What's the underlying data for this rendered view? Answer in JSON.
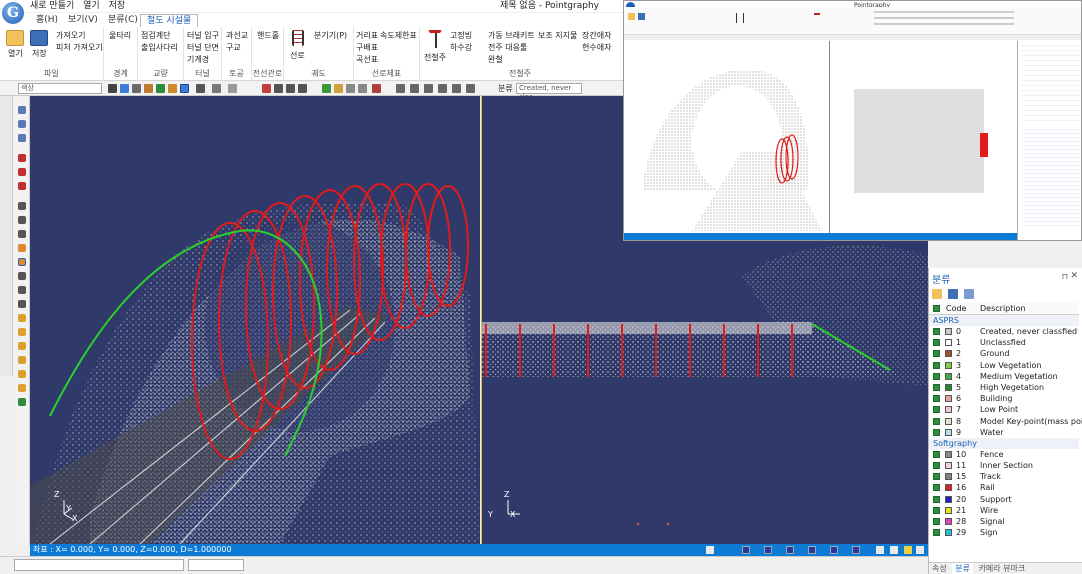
{
  "app": {
    "title": "제목 없음 - Pointgraphy",
    "logo_letter": "G",
    "quick_access": [
      "새로 만들기",
      "열기",
      "저장"
    ]
  },
  "ribbon_tabs": [
    {
      "label": "홈(H)"
    },
    {
      "label": "보기(V)"
    },
    {
      "label": "분류(C)"
    },
    {
      "label": "철도 시설물"
    }
  ],
  "ribbon": {
    "file": {
      "open": "열기",
      "save": "저장",
      "import": "가져오기",
      "feature_import": "피처 가져오기",
      "group": "파일"
    },
    "boundary": {
      "fence": "울타리",
      "group": "경계"
    },
    "bridge": {
      "stairs": "점검계단",
      "ladder": "출입사다리",
      "group": "교량"
    },
    "tunnel": {
      "entrance": "터널 입구",
      "section": "터널 단면",
      "machine_room": "기계경",
      "group": "터널"
    },
    "earthwork": {
      "overpass": "과선교",
      "culvert": "구교",
      "group": "토공"
    },
    "power": {
      "handhole": "핸드홀",
      "group": "전선관로"
    },
    "track": {
      "line": "선로",
      "switch": "분기기(P)",
      "group": "궤도"
    },
    "sign": {
      "distance": "거리표",
      "gradient": "구배표",
      "curve": "곡선표",
      "speed": "속도제한표",
      "group": "선로제표"
    },
    "catenary": {
      "pole": "전철주",
      "fixed_beam": "고정빔",
      "dropper": "하수강",
      "bracket": "가동 브래키트",
      "feeder": "전주 대응툴",
      "damper": "완철",
      "support": "보조 지지물",
      "insulator": "장간애자",
      "suspension": "현수애자",
      "group": "전철주"
    }
  },
  "toolbar": {
    "search_placeholder": "색상",
    "class_label": "분류",
    "class_value": "Created, never clas"
  },
  "status": {
    "coords": "좌표 : X=  0.000, Y=  0.000, Z=0.000, D=1.000000"
  },
  "viewports": {
    "left_axes": {
      "z": "Z",
      "y": "Y",
      "x": "X"
    },
    "right_axes": {
      "z": "Z",
      "y": "Y",
      "x": "X"
    }
  },
  "panel": {
    "title": "분류",
    "col_code": "Code",
    "col_desc": "Description",
    "groups": [
      {
        "name": "ASPRS",
        "rows": [
          {
            "code": "0",
            "desc": "Created, never classfied",
            "color": "#c8c8c8"
          },
          {
            "code": "1",
            "desc": "Unclassfied",
            "color": "#ffffff"
          },
          {
            "code": "2",
            "desc": "Ground",
            "color": "#a0522d"
          },
          {
            "code": "3",
            "desc": "Low Vegetation",
            "color": "#7cd04a"
          },
          {
            "code": "4",
            "desc": "Medium Vegetation",
            "color": "#3cb043"
          },
          {
            "code": "5",
            "desc": "High Vegetation",
            "color": "#1e8c2e"
          },
          {
            "code": "6",
            "desc": "Building",
            "color": "#e8a0a0"
          },
          {
            "code": "7",
            "desc": "Low Point",
            "color": "#f2c6d2"
          },
          {
            "code": "8",
            "desc": "Model Key-point(mass point)",
            "color": "#d8e8d0"
          },
          {
            "code": "9",
            "desc": "Water",
            "color": "#b0e0f0"
          }
        ]
      },
      {
        "name": "Softgraphy",
        "rows": [
          {
            "code": "10",
            "desc": "Fence",
            "color": "#8a8a8a"
          },
          {
            "code": "11",
            "desc": "Inner Section",
            "color": "#f4d0d0"
          },
          {
            "code": "15",
            "desc": "Track",
            "color": "#808080"
          },
          {
            "code": "16",
            "desc": "Rail",
            "color": "#e02020"
          },
          {
            "code": "20",
            "desc": "Support",
            "color": "#2020c0"
          },
          {
            "code": "21",
            "desc": "Wire",
            "color": "#f0e020"
          },
          {
            "code": "28",
            "desc": "Signal",
            "color": "#e040c0"
          },
          {
            "code": "29",
            "desc": "Sign",
            "color": "#20c0d0"
          }
        ]
      }
    ],
    "tabs": [
      "속성",
      "분류",
      "카메라 뷰마크"
    ]
  },
  "inset": {
    "title": "Pointgraphy"
  }
}
